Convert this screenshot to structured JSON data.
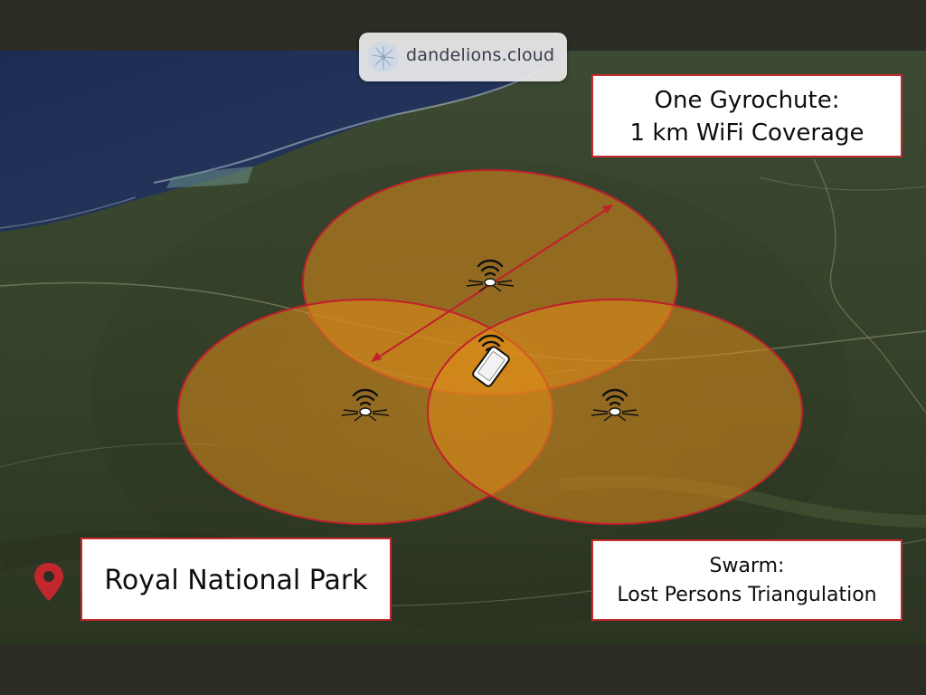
{
  "logo": {
    "text": "dandelions.cloud",
    "icon": "dandelion-logo-icon"
  },
  "callouts": {
    "coverage": {
      "lines": [
        "One Gyrochute:",
        "1 km WiFi Coverage"
      ]
    },
    "swarm": {
      "lines": [
        "Swarm:",
        "Lost Persons Triangulation"
      ]
    },
    "location": {
      "label": "Royal National Park",
      "icon": "location-pin-icon"
    }
  },
  "diagram": {
    "nodes": [
      {
        "kind": "gyrochute",
        "icon": "gyrochute-drone-icon",
        "signal": "wifi-signal-icon"
      },
      {
        "kind": "gyrochute",
        "icon": "gyrochute-drone-icon",
        "signal": "wifi-signal-icon"
      },
      {
        "kind": "gyrochute",
        "icon": "gyrochute-drone-icon",
        "signal": "wifi-signal-icon"
      },
      {
        "kind": "phone",
        "icon": "smartphone-icon",
        "signal": "wifi-signal-icon"
      }
    ],
    "range_indicator": "double-arrow-icon"
  },
  "colors": {
    "frame": "#2b2d24",
    "coverage_fill": "#e08c1a",
    "coverage_stroke": "#c21f2c",
    "callout_border": "#c52a2e",
    "pin": "#c1272d"
  }
}
